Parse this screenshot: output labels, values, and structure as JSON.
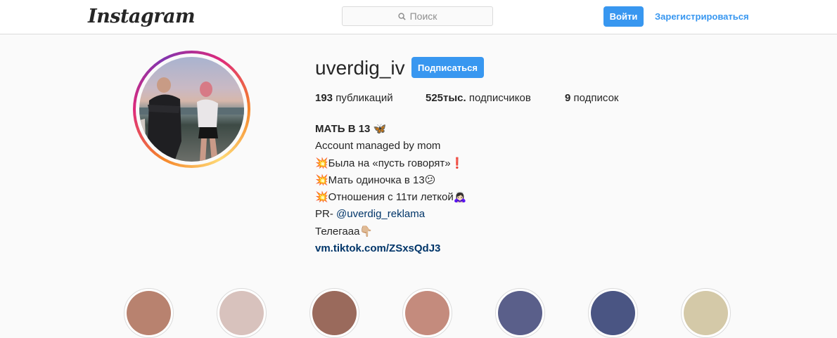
{
  "header": {
    "logo_text": "Instagram",
    "search_placeholder": "Поиск",
    "login_label": "Войти",
    "signup_label": "Зарегистрироваться"
  },
  "profile": {
    "username": "uverdig_iv",
    "follow_label": "Подписаться",
    "stats": {
      "posts_count": "193",
      "posts_label": "публикаций",
      "followers_count": "525тыс.",
      "followers_label": "подписчиков",
      "following_count": "9",
      "following_label": "подписок"
    },
    "bio": {
      "name": "МАТЬ В 13 🦋",
      "line1": "Account managed by mom",
      "line2": "💥Была на «пусть говорят»❗",
      "line3": "💥Мать одиночка в 13😕",
      "line4": "💥Отношения с 11ти леткой🙇🏻‍♀️",
      "pr_prefix": "PR- ",
      "pr_mention": "@uverdig_reklama",
      "line6": "Телегааа👇🏼",
      "link": "vm.tiktok.com/ZSxsQdJ3"
    }
  },
  "colors": {
    "accent": "#3897f0",
    "link": "#003569",
    "background": "#fafafa",
    "border": "#dbdbdb"
  },
  "highlights": [
    {
      "tint": "#b8826f"
    },
    {
      "tint": "#d8c2bd"
    },
    {
      "tint": "#9a6a5c"
    },
    {
      "tint": "#c48b7d"
    },
    {
      "tint": "#5a5f8a"
    },
    {
      "tint": "#4a5583"
    },
    {
      "tint": "#d4c9a8"
    }
  ]
}
